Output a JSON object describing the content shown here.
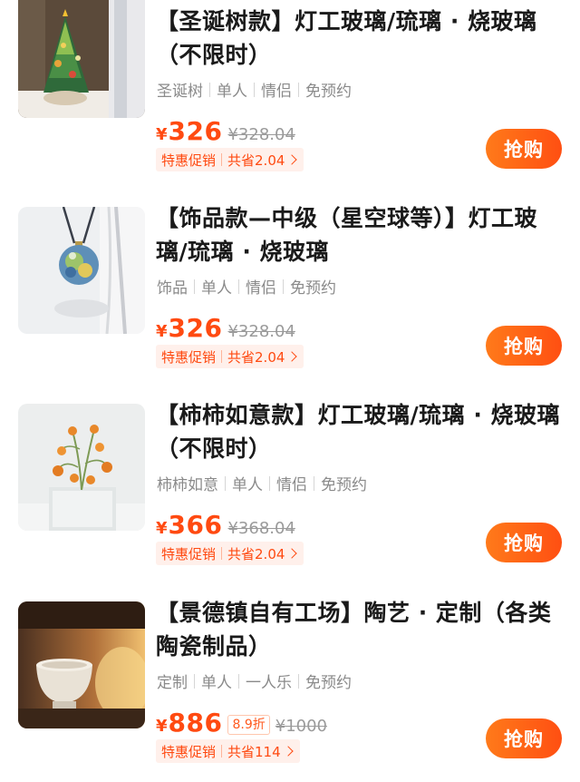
{
  "products": [
    {
      "title": "【圣诞树款】灯工玻璃/琉璃 · 烧玻璃（不限时）",
      "tags": [
        "圣诞树",
        "单人",
        "情侣",
        "免预约"
      ],
      "currency": "¥",
      "price": "326",
      "discount": "",
      "original_price": "¥328.04",
      "promo_label": "特惠促销",
      "promo_savings": "共省2.04",
      "buy_label": "抢购",
      "image_icon": "christmas-tree-glass-icon"
    },
    {
      "title": "【饰品款—中级（星空球等）】灯工玻璃/琉璃 · 烧玻璃",
      "tags": [
        "饰品",
        "单人",
        "情侣",
        "免预约"
      ],
      "currency": "¥",
      "price": "326",
      "discount": "",
      "original_price": "¥328.04",
      "promo_label": "特惠促销",
      "promo_savings": "共省2.04",
      "buy_label": "抢购",
      "image_icon": "glass-pendant-icon"
    },
    {
      "title": "【柿柿如意款】灯工玻璃/琉璃 · 烧玻璃（不限时）",
      "tags": [
        "柿柿如意",
        "单人",
        "情侣",
        "免预约"
      ],
      "currency": "¥",
      "price": "366",
      "discount": "",
      "original_price": "¥368.04",
      "promo_label": "特惠促销",
      "promo_savings": "共省2.04",
      "buy_label": "抢购",
      "image_icon": "persimmon-branch-icon"
    },
    {
      "title": "【景德镇自有工场】陶艺 · 定制（各类陶瓷制品）",
      "tags": [
        "定制",
        "单人",
        "一人乐",
        "免预约"
      ],
      "currency": "¥",
      "price": "886",
      "discount": "8.9折",
      "original_price": "¥1000",
      "promo_label": "特惠促销",
      "promo_savings": "共省114",
      "buy_label": "抢购",
      "image_icon": "ceramic-cup-icon"
    }
  ],
  "colors": {
    "accent": "#ff4a11",
    "button_start": "#ff7a1a",
    "button_end": "#ff4f12",
    "promo_bg": "#fff0eb",
    "tag_text": "#8a8a8a"
  }
}
